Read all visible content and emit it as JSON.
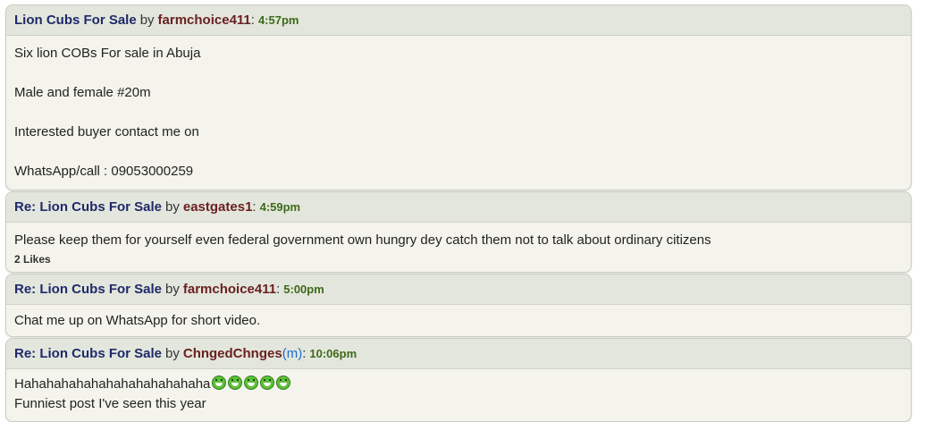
{
  "posts": [
    {
      "topic": "Lion Cubs For Sale",
      "by": "by",
      "user": "farmchoice411",
      "mod": "",
      "time": "4:57pm",
      "lines": [
        "Six lion COBs For sale in Abuja",
        "",
        "Male and female #20m",
        "",
        "Interested buyer contact me on",
        "",
        "WhatsApp/call : 09053000259"
      ],
      "likes": ""
    },
    {
      "topic": "Re: Lion Cubs For Sale",
      "by": "by",
      "user": "eastgates1",
      "mod": "",
      "time": "4:59pm",
      "lines": [
        "Please keep them for yourself even federal government own hungry dey catch them not to talk about ordinary citizens"
      ],
      "likes": "2 Likes"
    },
    {
      "topic": "Re: Lion Cubs For Sale",
      "by": "by",
      "user": "farmchoice411",
      "mod": "",
      "time": "5:00pm",
      "lines": [
        "Chat me up on WhatsApp for short video."
      ],
      "likes": ""
    },
    {
      "topic": "Re: Lion Cubs For Sale",
      "by": "by",
      "user": "ChngedChnges",
      "mod": "m",
      "time": "10:06pm",
      "lines": [
        "Hahahahahahahahahahahahaha",
        "Funniest post I've seen this year"
      ],
      "emoji_count": 5,
      "emoji_icon": "grin-emoji-icon",
      "likes": ""
    }
  ]
}
